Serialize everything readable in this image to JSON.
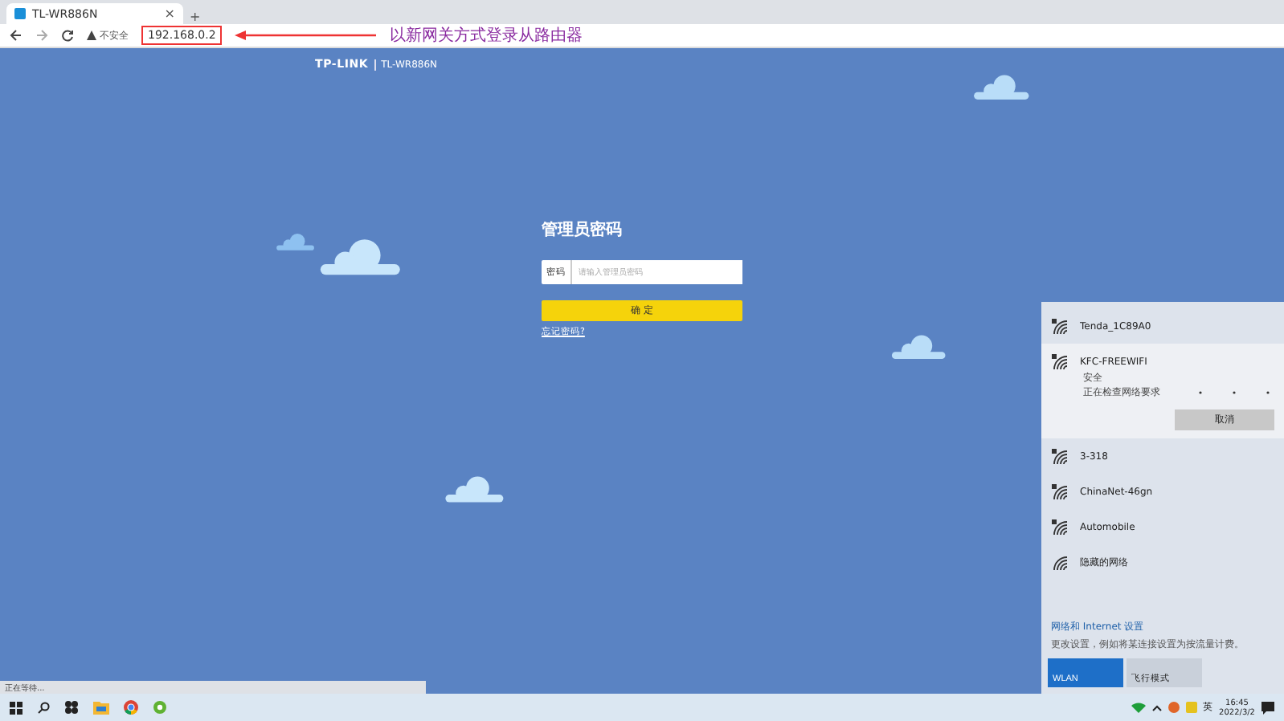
{
  "browser": {
    "tab": {
      "title": "TL-WR886N",
      "close": "×"
    },
    "new_tab": "+",
    "security": "不安全",
    "url": "192.168.0.2"
  },
  "annotation": {
    "text": "以新网关方式登录从路由器"
  },
  "page": {
    "brand": "TP-LINK",
    "model": "TL-WR886N",
    "title": "管理员密码",
    "field_label": "密码",
    "placeholder": "请输入管理员密码",
    "submit": "确 定",
    "forgot": "忘记密码?"
  },
  "status_bar": "正在等待...",
  "wifi_panel": {
    "networks": [
      {
        "name": "Tenda_1C89A0",
        "secured": true,
        "expanded": false
      },
      {
        "name": "KFC-FREEWIFI",
        "secured": true,
        "expanded": true,
        "security": "安全",
        "status": "正在检查网络要求",
        "action": "取消"
      },
      {
        "name": "3-318",
        "secured": true,
        "expanded": false
      },
      {
        "name": "ChinaNet-46gn",
        "secured": true,
        "expanded": false
      },
      {
        "name": "Automobile",
        "secured": true,
        "expanded": false
      },
      {
        "name": "隐藏的网络",
        "secured": false,
        "expanded": false
      }
    ],
    "settings_title": "网络和 Internet 设置",
    "settings_hint": "更改设置，例如将某连接设置为按流量计费。",
    "tiles": [
      {
        "label": "WLAN",
        "on": true
      },
      {
        "label": "飞行模式",
        "on": false
      }
    ]
  },
  "tray": {
    "ime": "英",
    "time": "16:45",
    "date": "2022/3/2"
  }
}
